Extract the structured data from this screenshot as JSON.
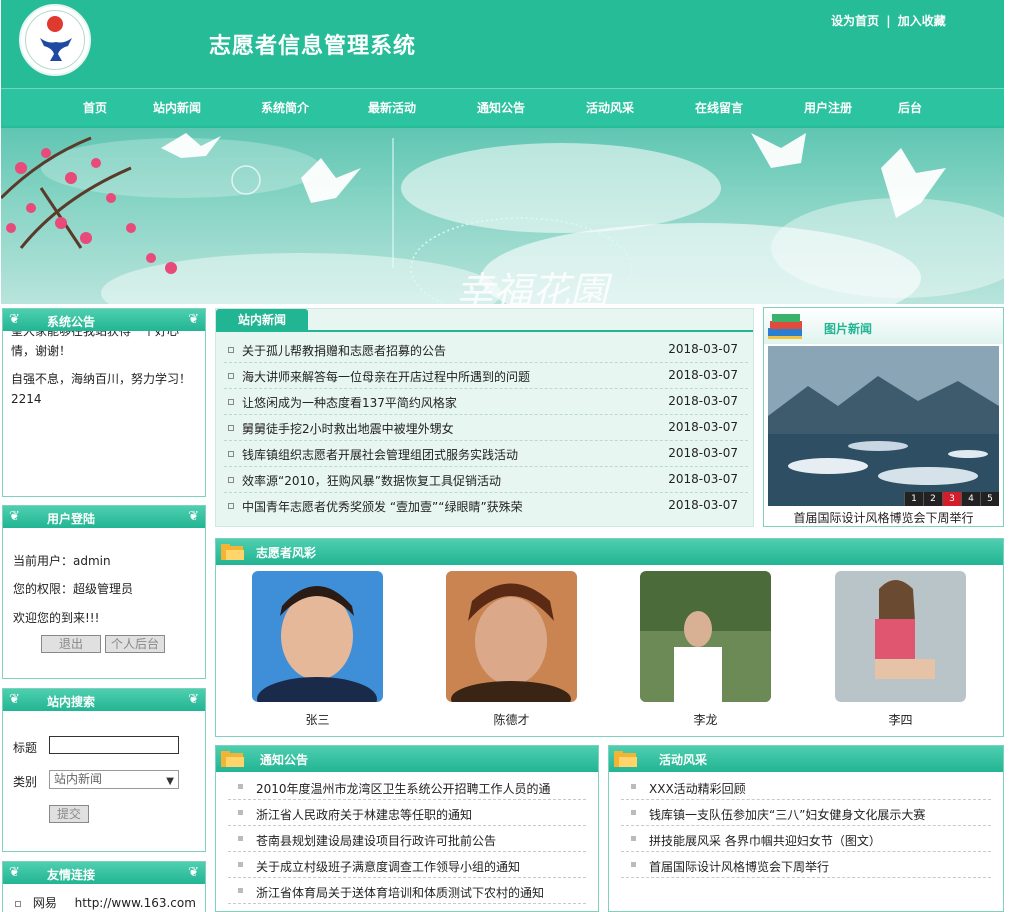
{
  "header": {
    "site_title": "志愿者信息管理系统",
    "set_home": "设为首页",
    "separator": "|",
    "add_favorite": "加入收藏"
  },
  "nav": [
    "首页",
    "站内新闻",
    "系统简介",
    "最新活动",
    "通知公告",
    "活动风采",
    "在线留言",
    "用户注册",
    "后台"
  ],
  "banner": {
    "overlay_text": "幸福花園"
  },
  "system_notice": {
    "title": "系统公告",
    "line1": "望大家能够在我站获得一个好心情，谢谢！",
    "line2": "自强不息，海纳百川，努力学习！2214"
  },
  "user_login": {
    "title": "用户登陆",
    "current_user": "当前用户：admin",
    "permission": "您的权限：超级管理员",
    "welcome": "欢迎您的到来!!!",
    "logout_button": "退出",
    "backend_button": "个人后台"
  },
  "site_search": {
    "title": "站内搜索",
    "title_label": "标题",
    "title_value": "",
    "category_label": "类别",
    "category_selected": "站内新闻",
    "submit_button": "提交"
  },
  "friend_links": {
    "title": "友情连接",
    "items": [
      {
        "name": "网易",
        "url": "http://www.163.com"
      }
    ]
  },
  "site_news": {
    "tab_label": "站内新闻",
    "items": [
      {
        "title": "关于孤儿帮教捐赠和志愿者招募的公告",
        "date": "2018-03-07"
      },
      {
        "title": "海大讲师来解答每一位母亲在开店过程中所遇到的问题",
        "date": "2018-03-07"
      },
      {
        "title": "让悠闲成为一种态度看137平简约风格家",
        "date": "2018-03-07"
      },
      {
        "title": "舅舅徒手挖2小时救出地震中被埋外甥女",
        "date": "2018-03-07"
      },
      {
        "title": "钱库镇组织志愿者开展社会管理组团式服务实践活动",
        "date": "2018-03-07"
      },
      {
        "title": "效率源“2010，狂购风暴”数据恢复工具促销活动",
        "date": "2018-03-07"
      },
      {
        "title": "中国青年志愿者优秀奖颁发 “壹加壹”“绿眼睛”获殊荣",
        "date": "2018-03-07"
      }
    ]
  },
  "picture_news": {
    "title": "图片新闻",
    "pager": [
      "1",
      "2",
      "3",
      "4",
      "5"
    ],
    "active_page": 3,
    "caption": "首届国际设计风格博览会下周举行"
  },
  "volunteers": {
    "title": "志愿者风彩",
    "people": [
      {
        "name": "张三"
      },
      {
        "name": "陈德才"
      },
      {
        "name": "李龙"
      },
      {
        "name": "李四"
      }
    ]
  },
  "notices": {
    "title": "通知公告",
    "items": [
      "2010年度温州市龙湾区卫生系统公开招聘工作人员的通",
      "浙江省人民政府关于林建忠等任职的通知",
      "苍南县规划建设局建设项目行政许可批前公告",
      "关于成立村级班子满意度调查工作领导小组的通知",
      "浙江省体育局关于送体育培训和体质测试下农村的通知"
    ]
  },
  "activity_gallery": {
    "title": "活动风采",
    "items": [
      "XXX活动精彩回顾",
      "钱库镇一支队伍参加庆“三八”妇女健身文化展示大赛",
      "拼技能展风采 各界巾帼共迎妇女节（图文）",
      "首届国际设计风格博览会下周举行"
    ]
  },
  "colors": {
    "brand_green": "#26bc98",
    "accent_red": "#d01f2a"
  }
}
